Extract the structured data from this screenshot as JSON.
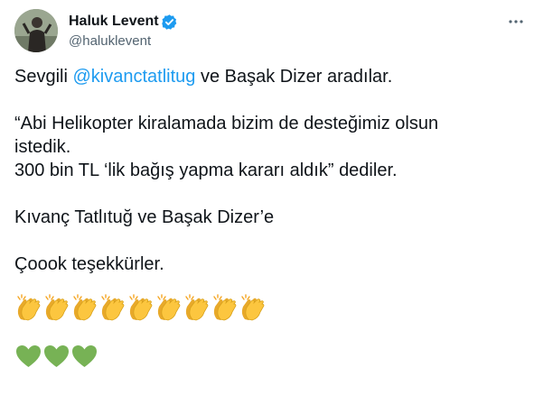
{
  "author": {
    "name": "Haluk Levent",
    "handle": "@haluklevent"
  },
  "icons": {
    "verified": "verified-badge-icon",
    "more": "more-options-icon",
    "clap": "clapping-hands-emoji",
    "heart": "green-heart-emoji"
  },
  "colors": {
    "text": "#0f1419",
    "secondary": "#536471",
    "link": "#1d9bf0",
    "verified": "#1d9bf0",
    "heart": "#77b255",
    "clap": "#f5c33b"
  },
  "tweet": {
    "line1_before": "Sevgili ",
    "mention": "@kivanctatlitug",
    "line1_after": " ve Başak Dizer aradılar.",
    "line2": "“Abi Helikopter kiralamada bizim de desteğimiz olsun",
    "line3": "istedik.",
    "line4": "300 bin TL ‘lik bağış yapma kararı aldık” dediler.",
    "line5": "Kıvanç Tatlıtuğ ve Başak Dizer’e",
    "line6": "Çoook teşekkürler.",
    "clap_count": 9,
    "heart_count": 3
  }
}
